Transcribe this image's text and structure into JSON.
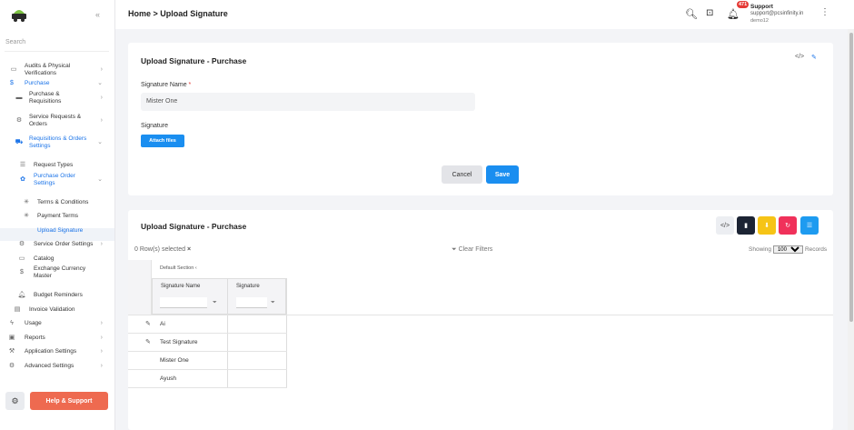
{
  "sidebar": {
    "search_placeholder": "Search",
    "collapse_icon": "double-chevron-left-icon",
    "items": [
      {
        "label": "Audits & Physical\nVerifications",
        "icon": "audit-icon"
      },
      {
        "label": "Purchase",
        "icon": "dollar-icon"
      },
      {
        "label": "Purchase &\nRequisitions",
        "icon": "ticket-icon"
      },
      {
        "label": "Service Requests &\nOrders",
        "icon": "gears-icon"
      },
      {
        "label": "Requisitions & Orders\nSettings",
        "icon": "cart-icon"
      },
      {
        "label": "Request Types",
        "icon": "list-icon"
      },
      {
        "label": "Purchase Order\nSettings",
        "icon": "gear-icon"
      },
      {
        "label": "Terms & Conditions",
        "icon": "asterisk-icon"
      },
      {
        "label": "Payment Terms",
        "icon": "asterisk-icon"
      },
      {
        "label": "Upload Signature",
        "icon": ""
      },
      {
        "label": "Service Order Settings",
        "icon": "gear-icon"
      },
      {
        "label": "Catalog",
        "icon": "catalog-icon"
      },
      {
        "label": "Exchange Currency\nMaster",
        "icon": "dollar-icon"
      },
      {
        "label": "Budget Reminders",
        "icon": "bell-icon"
      },
      {
        "label": "Invoice Validation",
        "icon": "document-icon"
      },
      {
        "label": "Usage",
        "icon": "bolt-icon"
      },
      {
        "label": "Reports",
        "icon": "report-icon"
      },
      {
        "label": "Application Settings",
        "icon": "wrench-icon"
      },
      {
        "label": "Advanced Settings",
        "icon": "gears-icon"
      }
    ],
    "help_label": "Help & Support"
  },
  "header": {
    "breadcrumb": "Home > Upload Signature",
    "notif_count": "471",
    "user_name": "Support",
    "user_email": "support@pcsinfinity.in",
    "user_company": "demo12"
  },
  "form_card": {
    "title": "Upload Signature - Purchase",
    "signature_name_label": "Signature Name",
    "required_mark": "*",
    "signature_name_value": "Mister One",
    "signature_label": "Signature",
    "attach_label": "Attach files",
    "cancel_label": "Cancel",
    "save_label": "Save"
  },
  "grid_card": {
    "title": "Upload Signature - Purchase",
    "rows_selected": "0 Row(s) selected",
    "clear_filters": "Clear Filters",
    "showing_label": "Showing",
    "records_label": "Records",
    "page_size": "100",
    "section_label": "Default Section",
    "columns": [
      "Signature Name",
      "Signature"
    ],
    "rows": [
      "Ai",
      "Test Signature",
      "Mister One",
      "Ayush"
    ],
    "toolbar_colors": {
      "code": "#eceef2",
      "doc": "#1c2434",
      "download": "#f6c416",
      "refresh": "#f0315a",
      "settings": "#1e9bf0"
    }
  }
}
